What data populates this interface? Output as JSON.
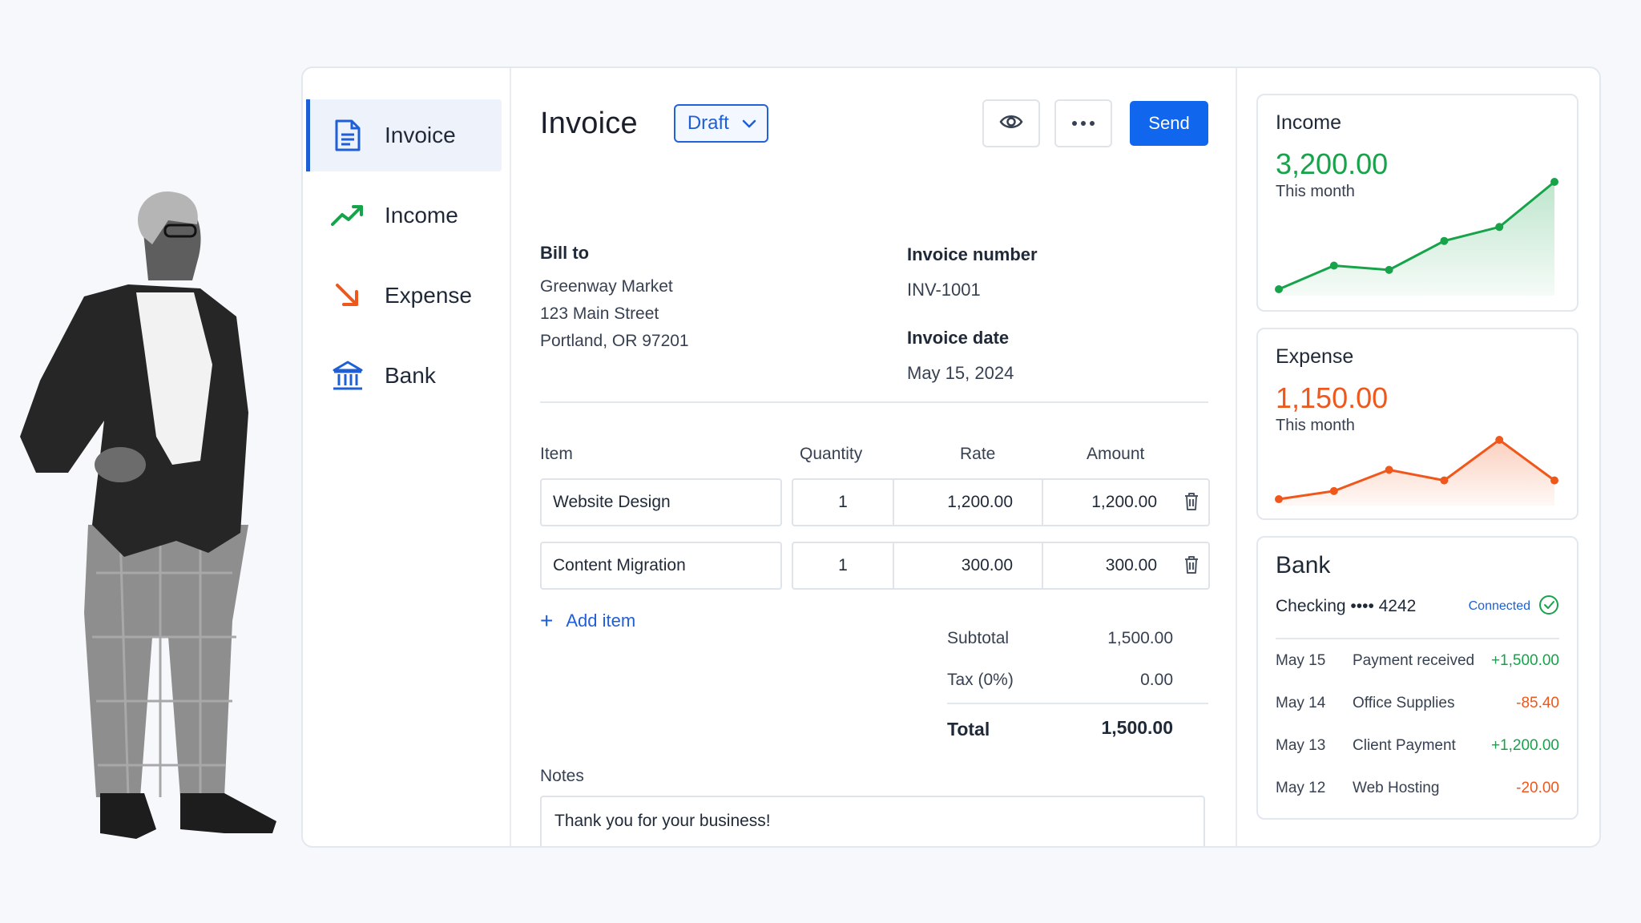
{
  "sidebar": {
    "items": [
      {
        "label": "Invoice",
        "icon": "document-icon",
        "active": true
      },
      {
        "label": "Income",
        "icon": "trend-up-icon",
        "active": false
      },
      {
        "label": "Expense",
        "icon": "arrow-down-right-icon",
        "active": false
      },
      {
        "label": "Bank",
        "icon": "bank-icon",
        "active": false
      }
    ]
  },
  "header": {
    "title": "Invoice",
    "status": "Draft",
    "send_label": "Send"
  },
  "bill_to": {
    "label": "Bill to",
    "name": "Greenway Market",
    "street": "123 Main Street",
    "city": "Portland, OR 97201"
  },
  "invoice_meta": {
    "number_label": "Invoice number",
    "number": "INV-1001",
    "date_label": "Invoice date",
    "date": "May 15, 2024"
  },
  "items_table": {
    "columns": [
      "Item",
      "Quantity",
      "Rate",
      "Amount"
    ],
    "rows": [
      {
        "item": "Website Design",
        "quantity": "1",
        "rate": "1,200.00",
        "amount": "1,200.00"
      },
      {
        "item": "Content Migration",
        "quantity": "1",
        "rate": "300.00",
        "amount": "300.00"
      }
    ],
    "add_label": "Add item"
  },
  "totals": {
    "subtotal_label": "Subtotal",
    "subtotal": "1,500.00",
    "tax_label": "Tax (0%)",
    "tax": "0.00",
    "total_label": "Total",
    "total": "1,500.00"
  },
  "notes": {
    "label": "Notes",
    "value": "Thank you for your business!"
  },
  "income_card": {
    "title": "Income",
    "amount": "3,200.00",
    "period": "This month",
    "color": "#16a34a"
  },
  "expense_card": {
    "title": "Expense",
    "amount": "1,150.00",
    "period": "This month",
    "color": "#f0571a"
  },
  "bank_card": {
    "title": "Bank",
    "account": "Checking •••• 4242",
    "status": "Connected",
    "transactions": [
      {
        "date": "May 15",
        "desc": "Payment received",
        "amount": "+1,500.00",
        "type": "credit"
      },
      {
        "date": "May 14",
        "desc": "Office Supplies",
        "amount": "-85.40",
        "type": "debit"
      },
      {
        "date": "May 13",
        "desc": "Client Payment",
        "amount": "+1,200.00",
        "type": "credit"
      },
      {
        "date": "May 12",
        "desc": "Web Hosting",
        "amount": "-20.00",
        "type": "debit"
      }
    ]
  },
  "chart_data": [
    {
      "type": "area",
      "series": [
        {
          "values": [
            0,
            22,
            18,
            45,
            58,
            100
          ]
        }
      ]
    },
    {
      "type": "area",
      "series": [
        {
          "values": [
            5,
            18,
            52,
            35,
            100,
            35
          ]
        }
      ]
    }
  ]
}
